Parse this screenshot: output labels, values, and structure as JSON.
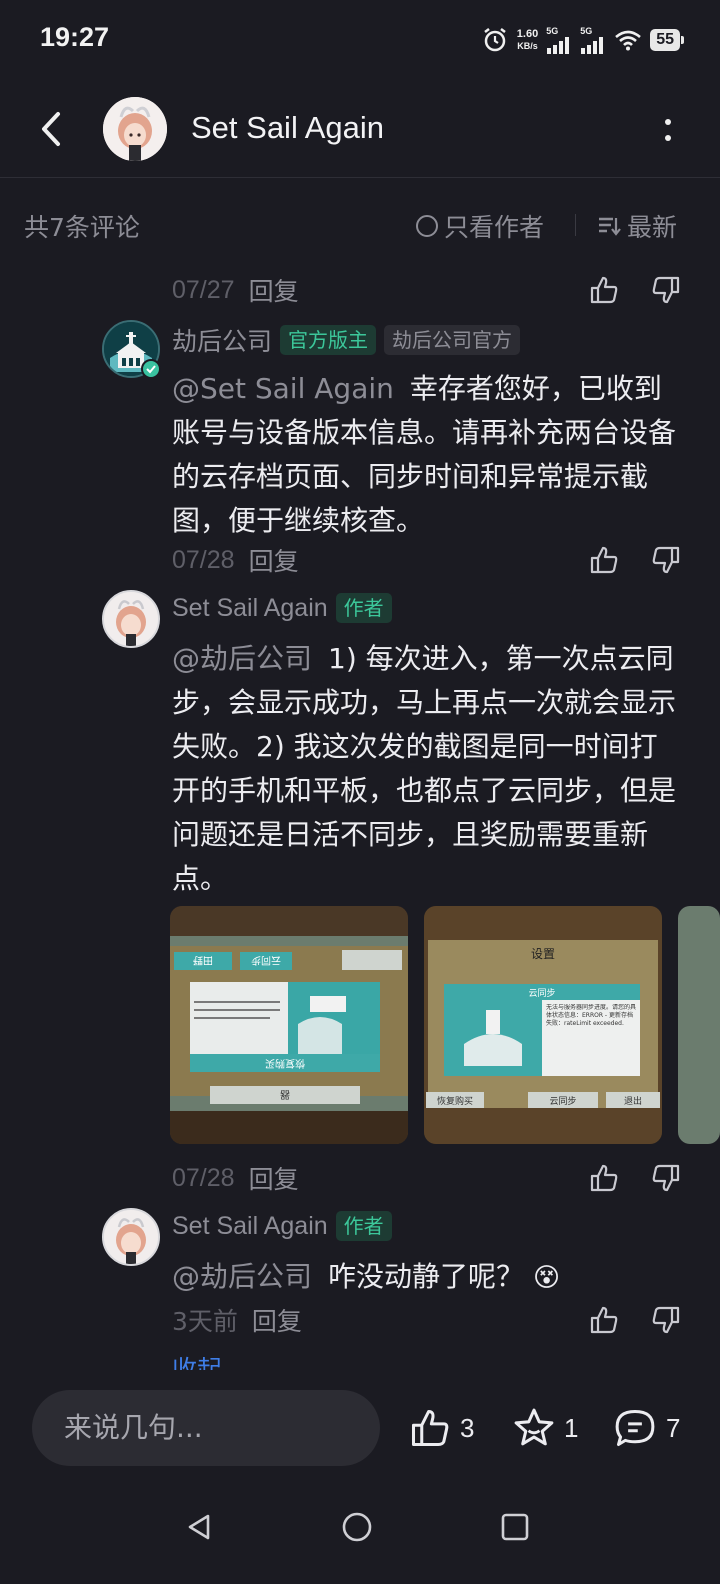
{
  "status_bar": {
    "time": "19:27",
    "net_speed_value": "1.60",
    "net_speed_unit": "KB/s",
    "sim1_label": "5G",
    "sim2_label": "5G",
    "battery": "55",
    "icons": [
      "alarm-icon",
      "signal-icon",
      "signal-icon",
      "wifi-icon",
      "battery-icon"
    ]
  },
  "header": {
    "title": "Set Sail Again",
    "icons": [
      "back-icon",
      "more-icon"
    ]
  },
  "filter_bar": {
    "count_label": "共7条评论",
    "author_only_label": "只看作者",
    "sort_label": "最新"
  },
  "comments": [
    {
      "date": "07/27",
      "reply_label": "回复"
    },
    {
      "author": "劫后公司",
      "tags": [
        "官方版主",
        "劫后公司官方"
      ],
      "mention": "@Set Sail Again",
      "text": "幸存者您好，已收到账号与设备版本信息。请再补充两台设备的云存档页面、同步时间和异常提示截图，便于继续核查。",
      "date": "07/28",
      "reply_label": "回复"
    },
    {
      "author": "Set Sail Again",
      "tags": [
        "作者"
      ],
      "mention": "@劫后公司",
      "text": "1) 每次进入，第一次点云同步，会显示成功，马上再点一次就会显示失败。2) 我这次发的截图是同一时间打开的手机和平板，也都点了云同步，但是问题还是日活不同步，且奖励需要重新点。",
      "images": [
        {
          "labels": [
            "田野",
            "云同步",
            "恢复购买",
            "器"
          ]
        },
        {
          "labels": [
            "设置",
            "云同步",
            "无法与服务器同步进度。请您的具体状态信息：ERROR - 更新存档失败：rateLimit exceeded.",
            "恢复购买",
            "云同步",
            "退出"
          ]
        }
      ],
      "date": "07/28",
      "reply_label": "回复"
    },
    {
      "author": "Set Sail Again",
      "tags": [
        "作者"
      ],
      "mention": "@劫后公司",
      "text": "咋没动静了呢？",
      "emoji": "😵",
      "date": "3天前",
      "reply_label": "回复"
    }
  ],
  "collapse_label": "收起",
  "bottom_bar": {
    "input_placeholder": "来说几句...",
    "like_count": "3",
    "favorite_count": "1",
    "comment_count": "7"
  },
  "colors": {
    "background": "#1b1b22",
    "accent_green": "#3cc79a",
    "link_blue": "#3f7ee8",
    "muted_text": "#8d8d96"
  }
}
